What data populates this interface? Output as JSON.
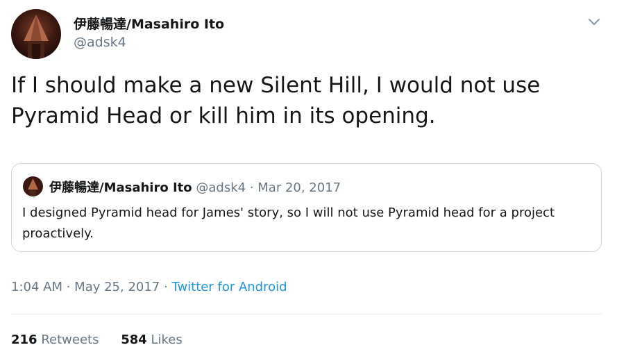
{
  "author": {
    "display_name": "伊藤暢達/Masahiro Ito",
    "handle": "@adsk4"
  },
  "tweet": {
    "text": "If I should make a new Silent Hill, I would not use Pyramid Head or kill him in its opening."
  },
  "quoted_tweet": {
    "display_name": "伊藤暢達/Masahiro Ito",
    "handle": "@adsk4",
    "separator": " · ",
    "date": "Mar 20, 2017",
    "text": "I designed Pyramid head for James' story, so I will not use Pyramid head for a project proactively."
  },
  "meta": {
    "time": "1:04 AM",
    "separator1": " · ",
    "date": "May 25, 2017",
    "separator2": " · ",
    "source": "Twitter for Android"
  },
  "stats": {
    "retweets_count": "216",
    "retweets_label": "Retweets",
    "likes_count": "584",
    "likes_label": "Likes"
  },
  "icons": {
    "caret": "chevron-down-icon"
  },
  "colors": {
    "text": "#14171a",
    "secondary": "#657786",
    "link": "#1b95e0",
    "border": "#ccd6dd"
  }
}
